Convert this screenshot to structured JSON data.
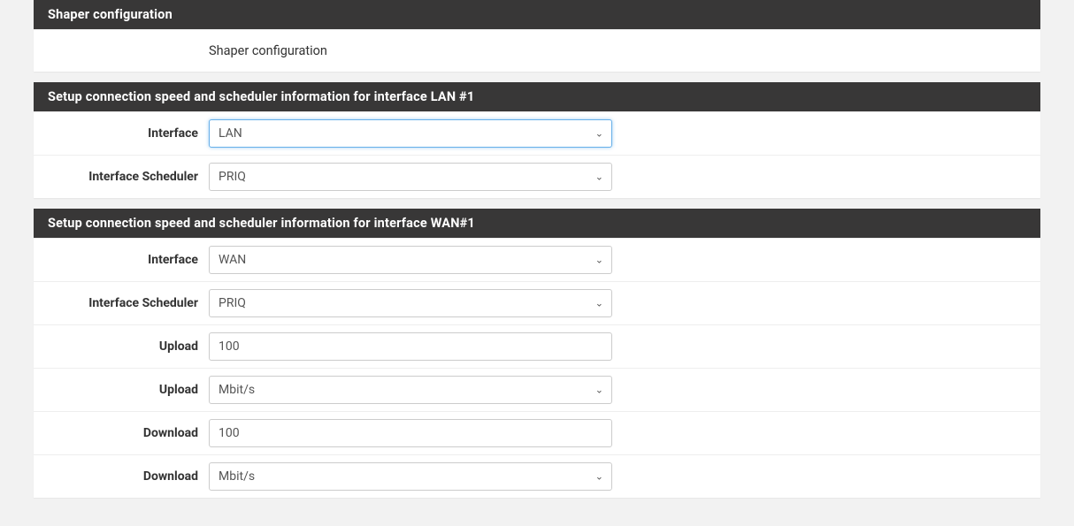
{
  "panels": [
    {
      "title": "Shaper configuration",
      "rows": [
        {
          "label": "",
          "type": "text",
          "value": "Shaper configuration"
        }
      ]
    },
    {
      "title": "Setup connection speed and scheduler information for interface LAN #1",
      "rows": [
        {
          "label": "Interface",
          "type": "select",
          "value": "LAN",
          "focused": true
        },
        {
          "label": "Interface Scheduler",
          "type": "select",
          "value": "PRIQ"
        }
      ]
    },
    {
      "title": "Setup connection speed and scheduler information for interface WAN#1",
      "rows": [
        {
          "label": "Interface",
          "type": "select",
          "value": "WAN"
        },
        {
          "label": "Interface Scheduler",
          "type": "select",
          "value": "PRIQ"
        },
        {
          "label": "Upload",
          "type": "input",
          "value": "100"
        },
        {
          "label": "Upload",
          "type": "select",
          "value": "Mbit/s"
        },
        {
          "label": "Download",
          "type": "input",
          "value": "100"
        },
        {
          "label": "Download",
          "type": "select",
          "value": "Mbit/s"
        }
      ]
    }
  ]
}
